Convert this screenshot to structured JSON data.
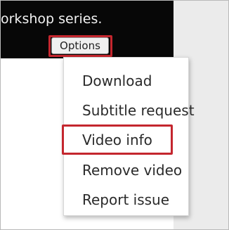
{
  "video": {
    "title_fragment": "orkshop series."
  },
  "options_button": {
    "label": "Options"
  },
  "menu": {
    "items": [
      {
        "label": "Download"
      },
      {
        "label": "Subtitle request"
      },
      {
        "label": "Video info",
        "highlighted": true
      },
      {
        "label": "Remove video"
      },
      {
        "label": "Report issue"
      }
    ]
  },
  "colors": {
    "video_background": "#070707",
    "highlight_border": "#c4262e",
    "side_band": "#ebebeb"
  }
}
